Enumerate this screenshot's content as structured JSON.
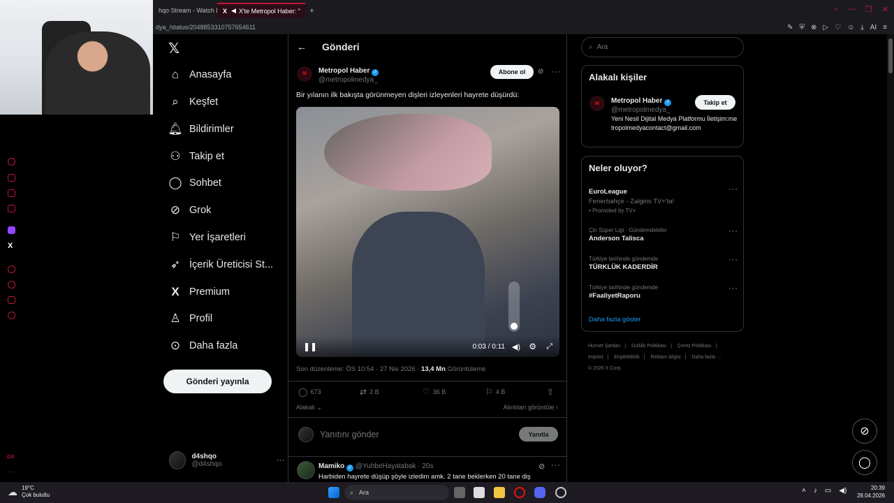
{
  "browser": {
    "tabs": [
      {
        "label": "hqo Stream - Watch L",
        "active": false
      },
      {
        "label": "X'te Metropol Haber: \"",
        "active": true
      }
    ],
    "url": "dya_/status/2048853310757654611",
    "new_tab": "+",
    "ai_label": "AI"
  },
  "nav": {
    "items": [
      {
        "label": "Anasayfa",
        "icon": "home-icon"
      },
      {
        "label": "Keşfet",
        "icon": "search-icon"
      },
      {
        "label": "Bildirimler",
        "icon": "bell-icon"
      },
      {
        "label": "Takip et",
        "icon": "add-person-icon"
      },
      {
        "label": "Sohbet",
        "icon": "chat-icon"
      },
      {
        "label": "Grok",
        "icon": "grok-icon"
      },
      {
        "label": "Yer İşaretleri",
        "icon": "bookmark-icon"
      },
      {
        "label": "İçerik Üreticisi St...",
        "icon": "rocket-icon"
      },
      {
        "label": "Premium",
        "icon": "x-logo-icon"
      },
      {
        "label": "Profil",
        "icon": "person-icon"
      },
      {
        "label": "Daha fazla",
        "icon": "more-circle-icon"
      }
    ],
    "post_button": "Gönderi yayınla",
    "account": {
      "name": "d4shqo",
      "handle": "@d4shqo"
    }
  },
  "post": {
    "header_title": "Gönderi",
    "author_name": "Metropol Haber",
    "author_handle": "@metropolmedya_",
    "subscribe_label": "Abone ol",
    "text": "Bir yılanın ilk bakışta görünmeyen dişleri izleyenleri hayrete düşürdü:",
    "video": {
      "time": "0:03 / 0:11",
      "progress": 0.27,
      "volume": 0.05
    },
    "meta_edit": "Son düzenleme: ÖS 10:54 · 27 Nis 2026 · ",
    "views_count": "13,4 Mn",
    "views_label": " Görüntüleme",
    "replies": "673",
    "reposts": "2 B",
    "likes": "36 B",
    "bookmarks": "4 B",
    "relevant_label": "Alakalı",
    "quotes_label": "Alıntıları görüntüle",
    "reply_placeholder": "Yanıtını gönder",
    "reply_button": "Yanıtla"
  },
  "next_post": {
    "name": "Mamiko",
    "handle": "@YuhbeHayatabak",
    "time": "· 20s",
    "text": "Harbiden hayrete düşüp şöyle izledim amk. 2 tane beklerken 20 tane diş"
  },
  "right": {
    "search_placeholder": "Ara",
    "related_title": "Alakalı kişiler",
    "related": {
      "name": "Metropol Haber",
      "handle": "@metropolmedya_",
      "bio": "Yeni Nesil Dijital Medya Platformu İletişim:metropolmedyacontact@gmail.com",
      "follow_label": "Takip et"
    },
    "trends_title": "Neler oluyor?",
    "trends": [
      {
        "context": "",
        "title": "EuroLeague",
        "desc": "Fenerbahçe - Zalgiris TV+'ta!",
        "promo": "Promoted by TV+"
      },
      {
        "context": "Çin Süper Ligi · Gündemdekiler",
        "title": "Anderson Talisca",
        "desc": "",
        "promo": ""
      },
      {
        "context": "Türkiye tarihinde gündemde",
        "title": "TÜRKLÜK KADERDİR",
        "desc": "",
        "promo": ""
      },
      {
        "context": "Türkiye tarihinde gündemde",
        "title": "#FaaliyetRaporu",
        "desc": "",
        "promo": ""
      }
    ],
    "show_more": "Daha fazla göster",
    "footer_links": [
      "Hizmet Şartları",
      "|",
      "Gizlilik Politikası",
      "|",
      "Çerez Politikası",
      "|",
      "Imprint",
      "|",
      "Erişilebilirlik",
      "|",
      "Reklam bilgisi",
      "|",
      "Daha fazla ···"
    ],
    "copyright": "© 2026 X Corp."
  },
  "taskbar": {
    "temp": "19°C",
    "weather": "Çok bulutlu",
    "search_placeholder": "Ara",
    "time": "20:39",
    "date": "28.04.2026"
  },
  "colors": {
    "accent": "#1d9bf0",
    "opera": "#c2163d",
    "bg": "#000000"
  }
}
